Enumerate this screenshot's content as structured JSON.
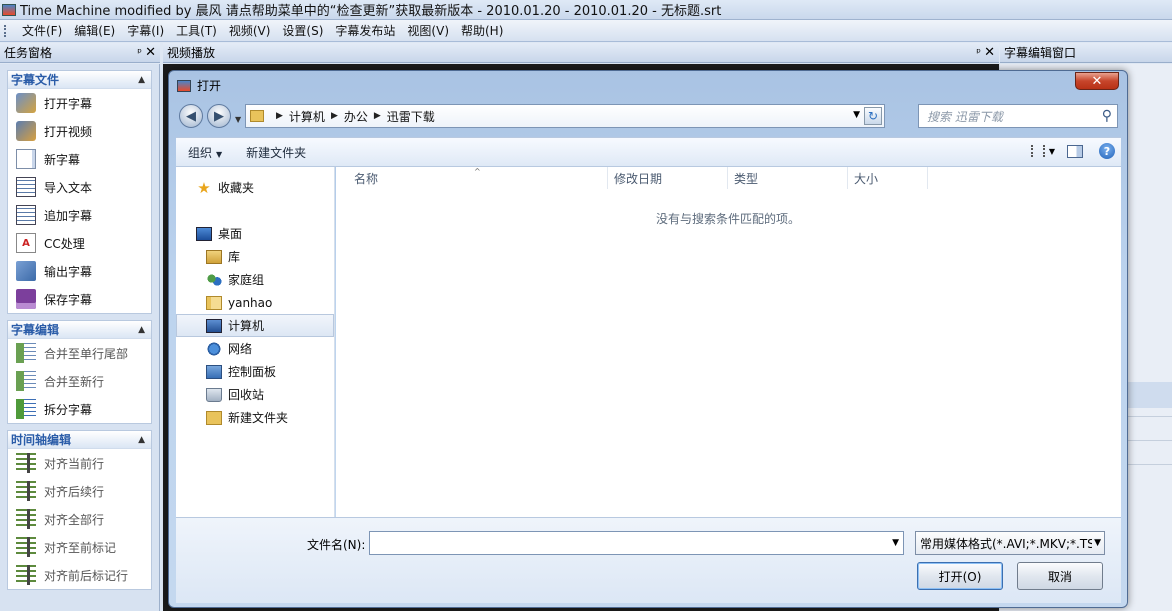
{
  "app": {
    "title": "Time Machine modified by 晨风 请点帮助菜单中的“检查更新”获取最新版本 - 2010.01.20 - 2010.01.20 - 无标题.srt"
  },
  "menu": [
    "文件(F)",
    "编辑(E)",
    "字幕(I)",
    "工具(T)",
    "视频(V)",
    "设置(S)",
    "字幕发布站",
    "视图(V)",
    "帮助(H)"
  ],
  "panes": {
    "task": "任务窗格",
    "video": "视频播放",
    "subtitle_edit": "字幕编辑窗口"
  },
  "taskpane": {
    "groups": [
      {
        "title": "字幕文件",
        "items": [
          {
            "label": "打开字幕",
            "icon": "open-subtitle-icon",
            "disabled": false
          },
          {
            "label": "打开视频",
            "icon": "open-video-icon",
            "disabled": false
          },
          {
            "label": "新字幕",
            "icon": "new-subtitle-icon",
            "disabled": false
          },
          {
            "label": "导入文本",
            "icon": "import-text-icon",
            "disabled": false
          },
          {
            "label": "追加字幕",
            "icon": "append-subtitle-icon",
            "disabled": false
          },
          {
            "label": "CC处理",
            "icon": "cc-process-icon",
            "disabled": false
          },
          {
            "label": "输出字幕",
            "icon": "export-subtitle-icon",
            "disabled": false
          },
          {
            "label": "保存字幕",
            "icon": "save-subtitle-icon",
            "disabled": false
          }
        ]
      },
      {
        "title": "字幕编辑",
        "items": [
          {
            "label": "合并至单行尾部",
            "icon": "merge-tail-icon",
            "disabled": true
          },
          {
            "label": "合并至新行",
            "icon": "merge-newline-icon",
            "disabled": true
          },
          {
            "label": "拆分字幕",
            "icon": "split-subtitle-icon",
            "disabled": false
          }
        ]
      },
      {
        "title": "时间轴编辑",
        "items": [
          {
            "label": "对齐当前行",
            "icon": "align-current-icon",
            "disabled": true
          },
          {
            "label": "对齐后续行",
            "icon": "align-following-icon",
            "disabled": true
          },
          {
            "label": "对齐全部行",
            "icon": "align-all-icon",
            "disabled": true
          },
          {
            "label": "对齐至前标记",
            "icon": "align-prev-mark-icon",
            "disabled": true
          },
          {
            "label": "对齐前后标记行",
            "icon": "align-marks-icon",
            "disabled": true
          }
        ]
      }
    ]
  },
  "dialog": {
    "title": "打开",
    "close": "✕",
    "breadcrumb": [
      "计算机",
      "办公",
      "迅雷下载"
    ],
    "search_placeholder": "搜索 迅雷下载",
    "toolbar": {
      "organize": "组织",
      "new_folder": "新建文件夹"
    },
    "nav": [
      {
        "label": "收藏夹",
        "icon": "favorites-star-icon"
      },
      {
        "label": "桌面",
        "icon": "desktop-icon"
      },
      {
        "label": "库",
        "icon": "library-icon"
      },
      {
        "label": "家庭组",
        "icon": "homegroup-icon"
      },
      {
        "label": "yanhao",
        "icon": "user-folder-icon"
      },
      {
        "label": "计算机",
        "icon": "computer-icon",
        "selected": true
      },
      {
        "label": "网络",
        "icon": "network-icon"
      },
      {
        "label": "控制面板",
        "icon": "control-panel-icon"
      },
      {
        "label": "回收站",
        "icon": "recycle-bin-icon"
      },
      {
        "label": "新建文件夹",
        "icon": "folder-icon"
      }
    ],
    "columns": [
      "名称",
      "修改日期",
      "类型",
      "大小"
    ],
    "empty_message": "没有与搜索条件匹配的项。",
    "filename_label": "文件名(N):",
    "filename_value": "",
    "filetype": "常用媒体格式(*.AVI;*.MKV;*.TS",
    "open_button": "打开(O)",
    "cancel_button": "取消"
  }
}
